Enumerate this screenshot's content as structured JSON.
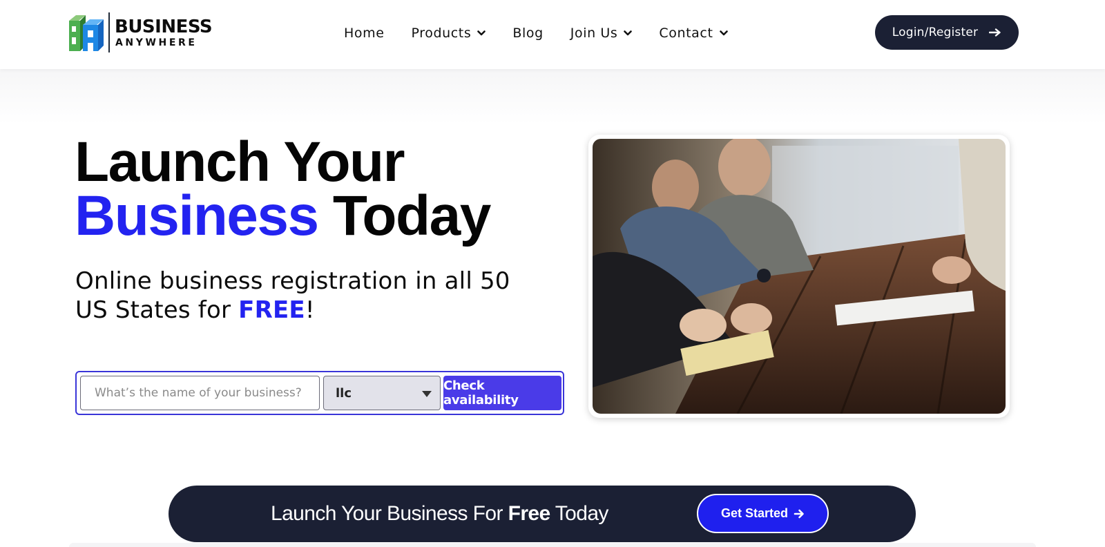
{
  "colors": {
    "accent": "#2323f0",
    "navy": "#1b2034",
    "button_purple": "#4a3be8",
    "cta_blue": "#1f20ee"
  },
  "header": {
    "logo": {
      "word1": "BUSINESS",
      "word2": "ANYWHERE",
      "icon": "ba-logo-icon"
    },
    "nav": [
      {
        "label": "Home",
        "has_dropdown": false
      },
      {
        "label": "Products",
        "has_dropdown": true
      },
      {
        "label": "Blog",
        "has_dropdown": false
      },
      {
        "label": "Join Us",
        "has_dropdown": true
      },
      {
        "label": "Contact",
        "has_dropdown": true
      }
    ],
    "login_label": "Login/Register",
    "login_icon": "arrow-right-icon"
  },
  "hero": {
    "headline_line1": "Launch Your",
    "headline_accent": "Business",
    "headline_rest": "Today",
    "subline_part1": "Online business registration in all 50 US States for",
    "subline_free": "FREE",
    "subline_end": "!",
    "form": {
      "placeholder": "What’s the name of your business?",
      "selected_type": "llc",
      "submit_label": "Check availability"
    },
    "photo_icon": "meeting-photo"
  },
  "banner": {
    "text_part1": "Launch Your Business For",
    "text_bold": "Free",
    "text_part2": "Today",
    "cta_label": "Get Started",
    "cta_icon": "arrow-right-icon"
  }
}
